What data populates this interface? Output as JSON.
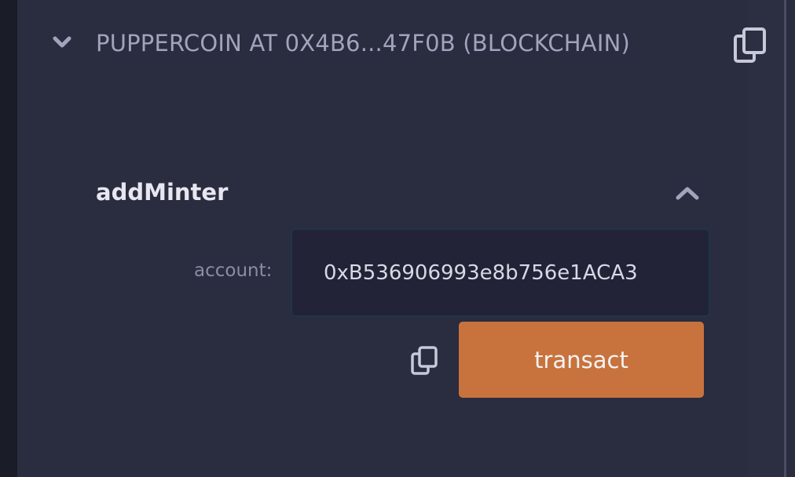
{
  "header": {
    "title": "PUPPERCOIN AT 0X4B6...47F0B (BLOCKCHAIN)",
    "expand_icon": "chevron-down-icon",
    "copy_icon": "copy-icon"
  },
  "function": {
    "name": "addMinter",
    "collapse_icon": "chevron-up-icon",
    "params": [
      {
        "label": "account:",
        "value": "0xB536906993e8b756e1ACA3"
      }
    ],
    "copy_icon": "copy-icon",
    "transact_label": "transact"
  },
  "colors": {
    "panel_bg": "#2a2c3f",
    "transact_button": "#c8733d",
    "input_bg": "#222336",
    "header_text": "#a2a3bd"
  }
}
